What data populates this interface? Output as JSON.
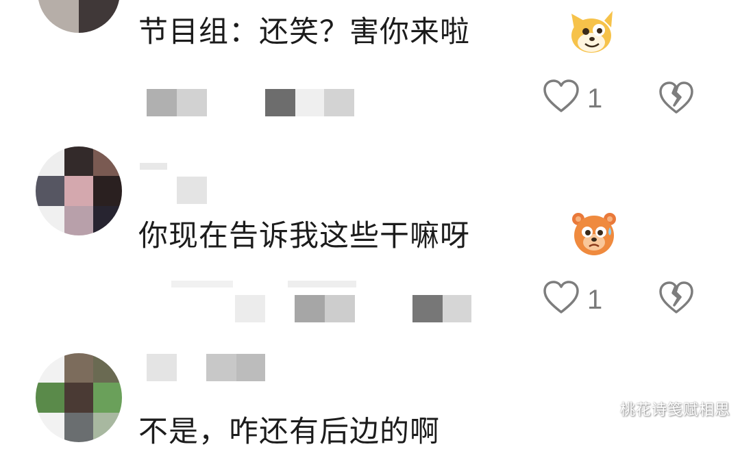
{
  "comments": [
    {
      "text": "节目组：还笑？害你来啦",
      "emoji": "laughing-dog-emoji",
      "likes": "1"
    },
    {
      "text": "你现在告诉我这些干嘛呀",
      "emoji": "sweating-bear-emoji",
      "likes": "1"
    },
    {
      "text": "不是，咋还有后边的啊"
    }
  ],
  "icons": {
    "like": "heart-outline-icon",
    "dislike": "broken-heart-icon"
  },
  "watermark": "桃花诗笺赋相思"
}
